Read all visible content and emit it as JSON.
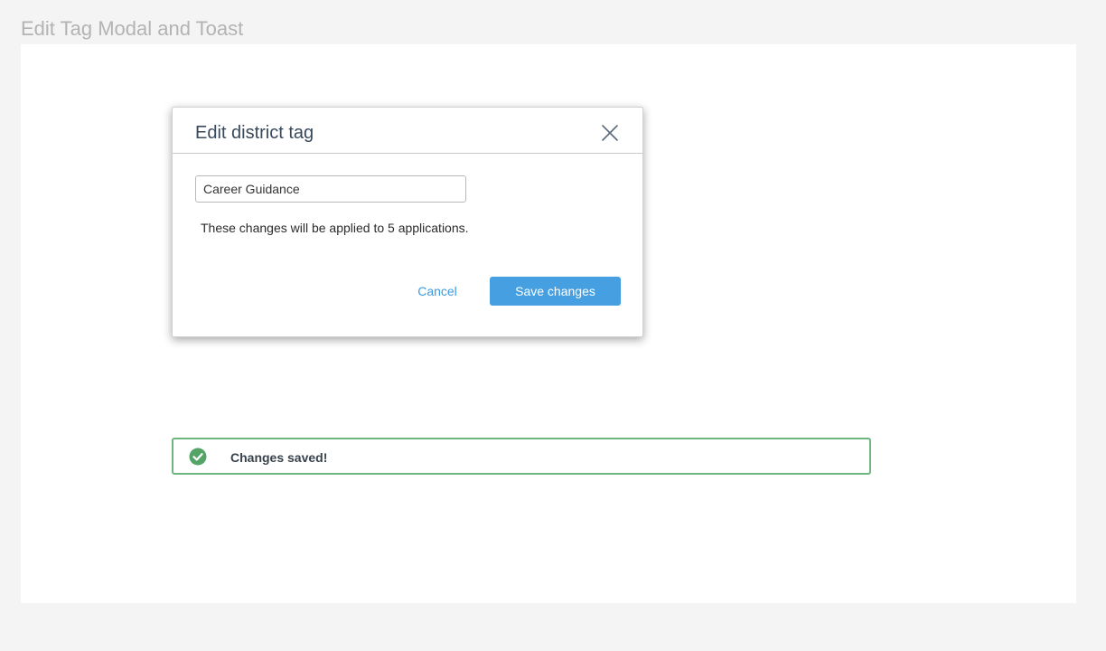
{
  "frame": {
    "title": "Edit Tag Modal and Toast"
  },
  "modal": {
    "title": "Edit district tag",
    "close_icon": "close-icon",
    "input_value": "Career Guidance",
    "note": "These changes will be applied to 5 applications.",
    "cancel_label": "Cancel",
    "save_label": "Save changes"
  },
  "toast": {
    "icon": "check-circle-icon",
    "message": "Changes saved!"
  },
  "colors": {
    "accent_blue": "#459fe0",
    "link_blue": "#3c9be0",
    "success_green": "#6eb57f",
    "title_text": "#38495c",
    "frame_background": "#f4f4f4"
  }
}
